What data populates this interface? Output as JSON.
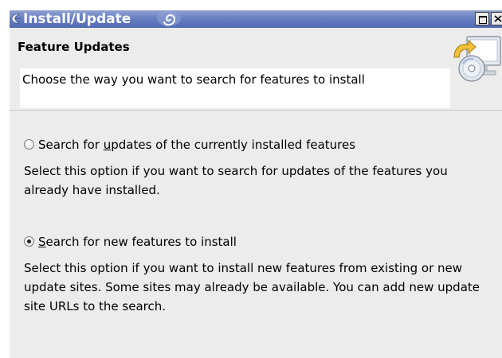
{
  "window": {
    "title": "Install/Update",
    "icons": {
      "menu": "eclipse-menu-icon",
      "app": "swirl-app-icon",
      "maximize": "maximize-icon",
      "close": "close-icon"
    }
  },
  "header": {
    "title": "Feature Updates",
    "description": "Choose the way you want to search for features to install",
    "icon": "install-update-wizard-icon"
  },
  "options": [
    {
      "label_before": "Search for ",
      "label_mnemonic": "u",
      "label_after": "pdates of the currently installed features",
      "selected": false,
      "description": "Select this option if you want to search for updates of the features you already have installed."
    },
    {
      "label_before": "",
      "label_mnemonic": "S",
      "label_after": "earch for new features to install",
      "selected": true,
      "description": "Select this option if you want to install new features from existing or new update sites. Some sites may already be available. You can add new update site URLs to the search."
    }
  ],
  "colors": {
    "titlebar": "#6a80c2",
    "background": "#ececec",
    "description_box": "#ffffff"
  }
}
